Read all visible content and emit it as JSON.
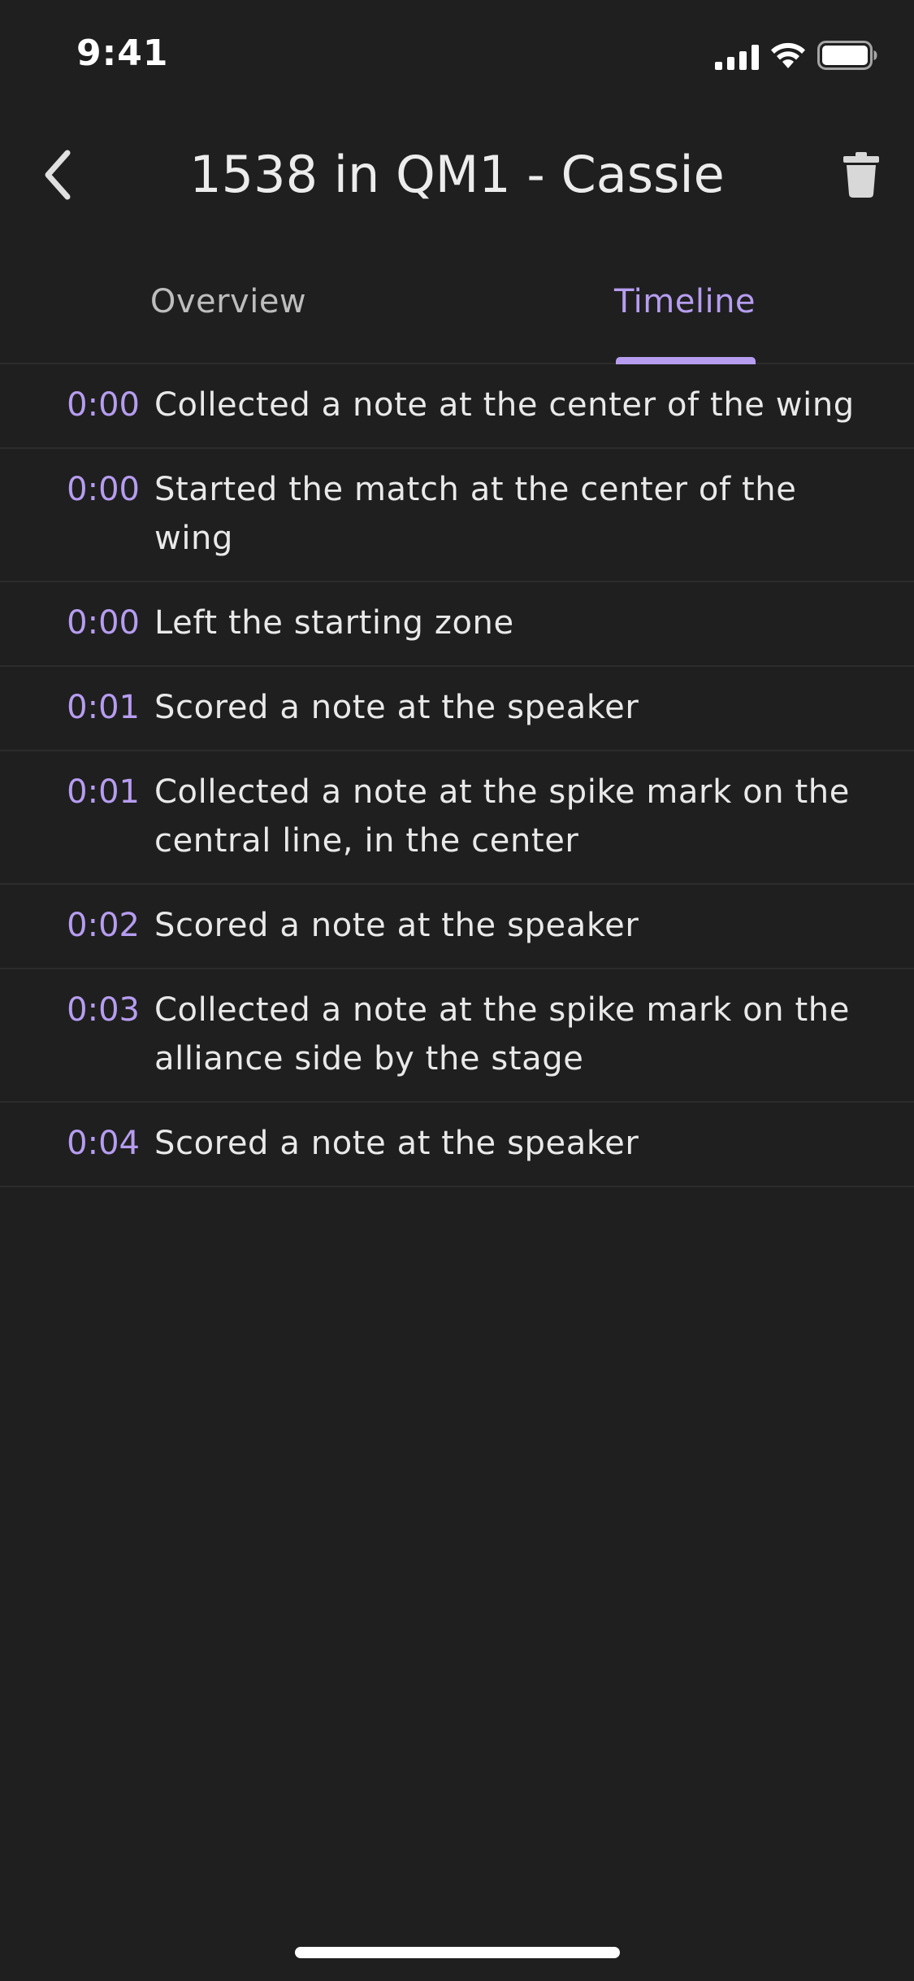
{
  "status_bar": {
    "time": "9:41",
    "icons": [
      "cellular-signal-icon",
      "wifi-icon",
      "battery-icon"
    ]
  },
  "header": {
    "title": "1538 in QM1 - Cassie",
    "back_icon": "chevron-left-icon",
    "delete_icon": "trash-icon"
  },
  "tabs": [
    {
      "label": "Overview",
      "selected": false
    },
    {
      "label": "Timeline",
      "selected": true
    }
  ],
  "timeline": [
    {
      "time": "0:00",
      "text": "Collected a note at the center of the wing"
    },
    {
      "time": "0:00",
      "text": "Started the match at the center of the wing"
    },
    {
      "time": "0:00",
      "text": "Left the starting zone"
    },
    {
      "time": "0:01",
      "text": "Scored a note at the speaker"
    },
    {
      "time": "0:01",
      "text": "Collected a note at the spike mark on the central line, in the center"
    },
    {
      "time": "0:02",
      "text": "Scored a note at the speaker"
    },
    {
      "time": "0:03",
      "text": "Collected a note at the spike mark on the alliance side by the stage"
    },
    {
      "time": "0:04",
      "text": "Scored a note at the speaker"
    }
  ],
  "colors": {
    "background": "#1f1f1f",
    "accent": "#b69df0",
    "text": "#e9e9e9",
    "divider": "#2c2c2c"
  }
}
